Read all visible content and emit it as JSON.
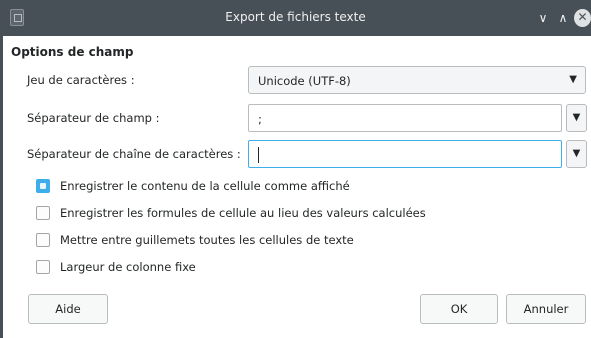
{
  "window": {
    "title": "Export de fichiers texte",
    "controls": {
      "minimize": "∨",
      "maximize": "∧",
      "close": "✕"
    }
  },
  "section": {
    "title": "Options de champ"
  },
  "fields": {
    "charset": {
      "label": "Jeu de caractères :",
      "value": "Unicode (UTF-8)"
    },
    "field_separator": {
      "label": "Séparateur de champ :",
      "value": ";"
    },
    "string_separator": {
      "label": "Séparateur de chaîne de caractères :",
      "value": ""
    }
  },
  "options": [
    {
      "label": "Enregistrer le contenu de la cellule comme affiché",
      "checked": true
    },
    {
      "label": "Enregistrer les formules de cellule au lieu des valeurs calculées",
      "checked": false
    },
    {
      "label": "Mettre entre guillemets toutes les cellules de texte",
      "checked": false
    },
    {
      "label": "Largeur de colonne fixe",
      "checked": false
    }
  ],
  "buttons": {
    "help": "Aide",
    "ok": "OK",
    "cancel": "Annuler"
  },
  "icons": {
    "dropdown": "▼"
  },
  "colors": {
    "titlebar": "#475057",
    "accent": "#3daee9"
  }
}
